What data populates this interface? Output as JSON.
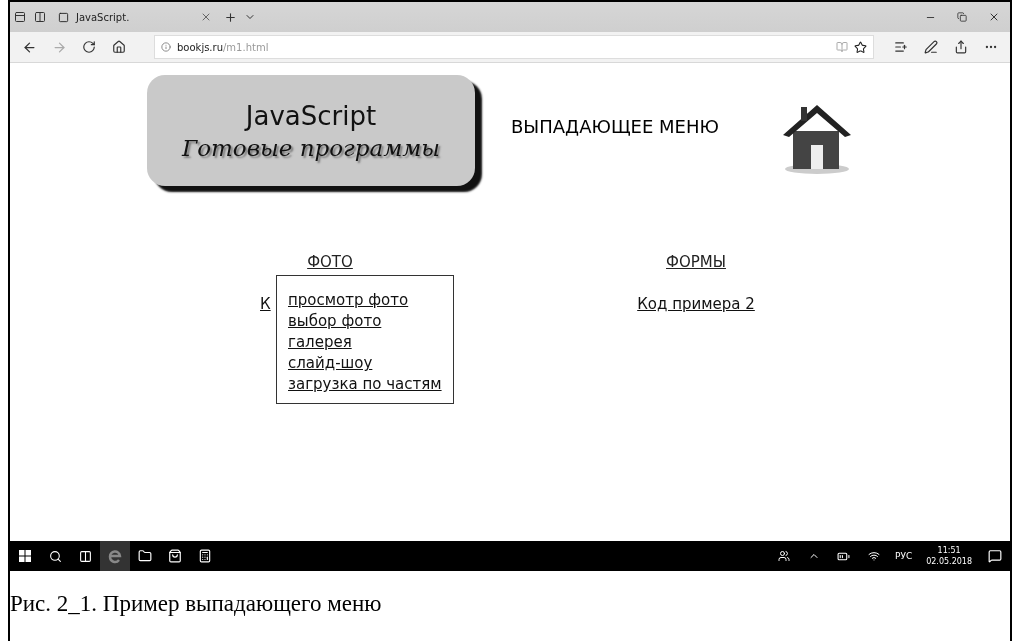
{
  "browser": {
    "tab_title": "JavaScript.",
    "url_host": "bookjs.ru",
    "url_path": "/m1.html"
  },
  "page": {
    "logo": {
      "line_1": "JavaScript",
      "line_2": "Готовые программы"
    },
    "heading": "ВЫПАДАЮЩЕЕ МЕНЮ",
    "nav": [
      {
        "label": "ФОТО",
        "link": "К",
        "menu": [
          "просмотр фото",
          "выбор фото",
          "галерея",
          "слайд-шоу",
          "загрузка по частям"
        ]
      },
      {
        "label": "ФОРМЫ",
        "link": "Код примера 2"
      }
    ]
  },
  "taskbar": {
    "language": "РУС",
    "time": "11:51",
    "date": "02.05.2018"
  },
  "caption": "Рис. 2_1. Пример выпадающего меню"
}
